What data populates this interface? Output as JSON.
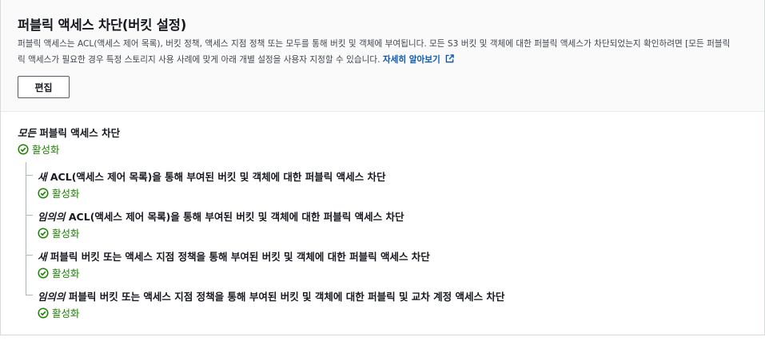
{
  "header": {
    "title": "퍼블릭 액세스 차단(버킷 설정)",
    "description_line1": "퍼블릭 액세스는 ACL(액세스 제어 목록), 버킷 정책, 액세스 지점 정책 또는 모두를 통해 버킷 및 객체에 부여됩니다. 모든 S3 버킷 및 객체에 대한 퍼블릭 액세스가 차단되었는지 확인하려면 [모든 퍼블릭",
    "description_line2": "릭 액세스가 필요한 경우 특정 스토리지 사용 사례에 맞게 아래 개별 설정을 사용자 지정할 수 있습니다.",
    "learn_more": "자세히 알아보기",
    "edit_button": "편집"
  },
  "block_all": {
    "prefix": "모든",
    "label": "퍼블릭 액세스 차단",
    "status": "활성화"
  },
  "settings": [
    {
      "prefix": "새",
      "label": "ACL(액세스 제어 목록)을 통해 부여된 버킷 및 객체에 대한 퍼블릭 액세스 차단",
      "status": "활성화"
    },
    {
      "prefix": "임의의",
      "label": "ACL(액세스 제어 목록)을 통해 부여된 버킷 및 객체에 대한 퍼블릭 액세스 차단",
      "status": "활성화"
    },
    {
      "prefix": "새",
      "label": "퍼블릭 버킷 또는 액세스 지점 정책을 통해 부여된 버킷 및 객체에 대한 퍼블릭 액세스 차단",
      "status": "활성화"
    },
    {
      "prefix": "임의의",
      "label": "퍼블릭 버킷 또는 액세스 지점 정책을 통해 부여된 버킷 및 객체에 대한 퍼블릭 및 교차 계정 액세스 차단",
      "status": "활성화"
    }
  ],
  "colors": {
    "enabled": "#1d8102",
    "link": "#0a56b4"
  },
  "icons": {
    "status": "check-circle-icon",
    "learn_more": "external-link-icon"
  }
}
